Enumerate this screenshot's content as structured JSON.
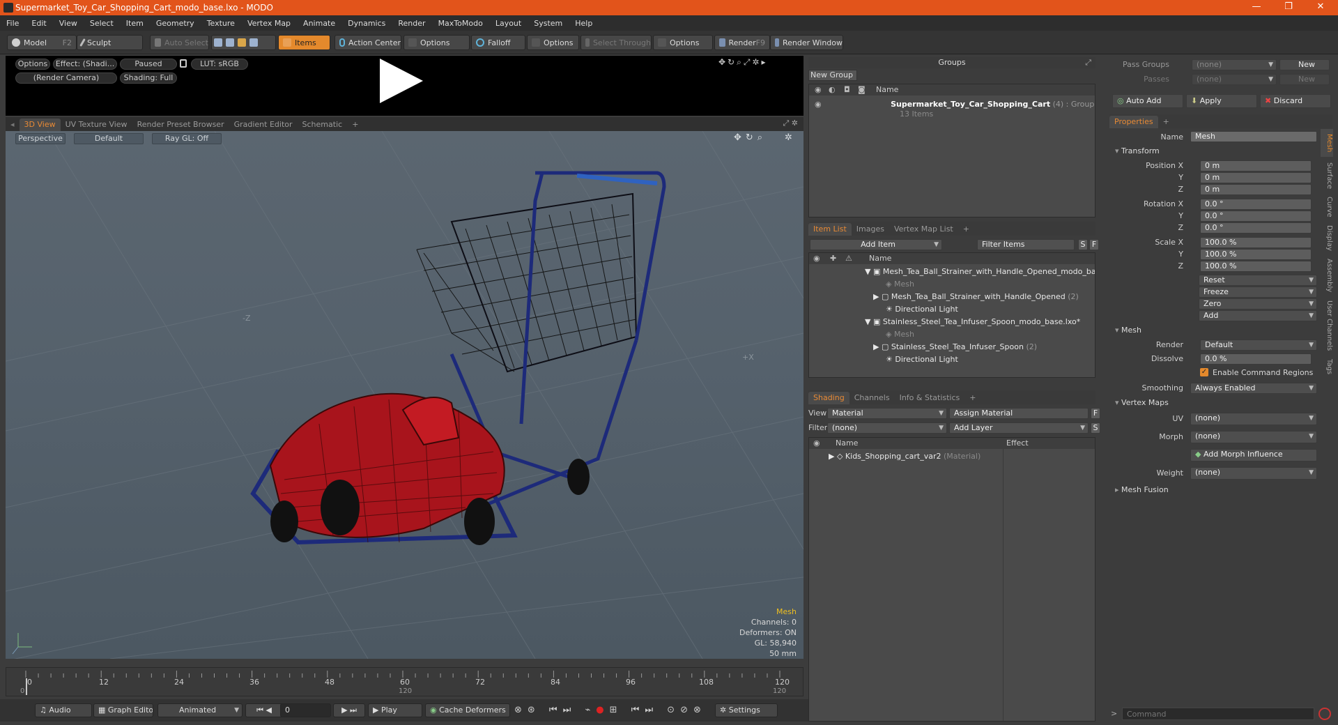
{
  "window": {
    "title": "Supermarket_Toy_Car_Shopping_Cart_modo_base.lxo - MODO"
  },
  "menu": [
    "File",
    "Edit",
    "View",
    "Select",
    "Item",
    "Geometry",
    "Texture",
    "Vertex Map",
    "Animate",
    "Dynamics",
    "Render",
    "MaxToModo",
    "Layout",
    "System",
    "Help"
  ],
  "toolbar": {
    "model": "Model",
    "model_key": "F2",
    "sculpt": "Sculpt",
    "auto_select": "Auto Select",
    "items": "Items",
    "action_center": "Action Center",
    "options": "Options",
    "falloff": "Falloff",
    "select_through": "Select Through",
    "render": "Render",
    "render_key": "F9",
    "render_window": "Render Window"
  },
  "preview": {
    "options": "Options",
    "effect": "Effect: (Shadi...",
    "paused": "Paused",
    "lut": "LUT: sRGB",
    "camera": "(Render Camera)",
    "shading": "Shading: Full"
  },
  "viewport_tabs": [
    "3D View",
    "UV Texture View",
    "Render Preset Browser",
    "Gradient Editor",
    "Schematic",
    "+"
  ],
  "viewport": {
    "perspective": "Perspective",
    "default": "Default",
    "raygl": "Ray GL: Off",
    "axis_z": "-Z",
    "axis_x": "+X",
    "info": {
      "mesh": "Mesh",
      "channels": "Channels: 0",
      "deformers": "Deformers: ON",
      "gl": "GL: 58,940",
      "focal": "50 mm"
    }
  },
  "timeline": {
    "ticks": [
      "0",
      "12",
      "24",
      "36",
      "48",
      "60",
      "72",
      "84",
      "96",
      "108",
      "120"
    ],
    "end": "120",
    "sub0": "0",
    "sub120": "120"
  },
  "bottom": {
    "audio": "Audio",
    "graph_editor": "Graph Editor",
    "animated": "Animated",
    "frame": "0",
    "play": "Play",
    "cache": "Cache Deformers",
    "settings": "Settings"
  },
  "groups": {
    "title": "Groups",
    "new_group": "New Group",
    "col_name": "Name",
    "item_name": "Supermarket_Toy_Car_Shopping_Cart",
    "item_count": "(4)",
    "item_type": ": Group",
    "item_sub": "13 Items"
  },
  "itemlist": {
    "tabs": [
      "Item List",
      "Images",
      "Vertex Map List",
      "+"
    ],
    "add_item": "Add Item",
    "filter": "Filter Items",
    "s": "S",
    "f": "F",
    "col_name": "Name",
    "rows": [
      {
        "label": "Mesh_Tea_Ball_Strainer_with_Handle_Opened_modo_bas ...",
        "count": ""
      },
      {
        "label": "Mesh",
        "count": ""
      },
      {
        "label": "Mesh_Tea_Ball_Strainer_with_Handle_Opened",
        "count": "(2)"
      },
      {
        "label": "Directional Light",
        "count": ""
      },
      {
        "label": "Stainless_Steel_Tea_Infuser_Spoon_modo_base.lxo*",
        "count": ""
      },
      {
        "label": "Mesh",
        "count": ""
      },
      {
        "label": "Stainless_Steel_Tea_Infuser_Spoon",
        "count": "(2)"
      },
      {
        "label": "Directional Light",
        "count": ""
      }
    ]
  },
  "shading": {
    "tabs": [
      "Shading",
      "Channels",
      "Info & Statistics",
      "+"
    ],
    "view_label": "View",
    "view_val": "Material",
    "assign": "Assign Material",
    "filter_label": "Filter",
    "filter_val": "(none)",
    "add_layer": "Add Layer",
    "s": "S",
    "f": "F",
    "col_name": "Name",
    "col_effect": "Effect",
    "material": "Kids_Shopping_cart_var2",
    "material_type": "(Material)"
  },
  "passes": {
    "pass_groups": "Pass Groups",
    "passes": "Passes",
    "none": "(none)",
    "new": "New"
  },
  "actions": {
    "auto_add": "Auto Add",
    "apply": "Apply",
    "discard": "Discard"
  },
  "properties": {
    "tab": "Properties",
    "plus": "+",
    "name_label": "Name",
    "name_val": "Mesh",
    "transform": "Transform",
    "pos_label": "Position X",
    "y": "Y",
    "z": "Z",
    "pos": [
      "0 m",
      "0 m",
      "0 m"
    ],
    "rot_label": "Rotation X",
    "rot": [
      "0.0 °",
      "0.0 °",
      "0.0 °"
    ],
    "scale_label": "Scale X",
    "scale": [
      "100.0 %",
      "100.0 %",
      "100.0 %"
    ],
    "buttons": [
      "Reset",
      "Freeze",
      "Zero",
      "Add"
    ],
    "mesh": "Mesh",
    "render_label": "Render",
    "render_val": "Default",
    "dissolve_label": "Dissolve",
    "dissolve_val": "0.0 %",
    "enable_cmd": "Enable Command Regions",
    "smoothing_label": "Smoothing",
    "smoothing_val": "Always Enabled",
    "vertex_maps": "Vertex Maps",
    "uv_label": "UV",
    "uv_val": "(none)",
    "morph_label": "Morph",
    "morph_val": "(none)",
    "add_morph": "Add Morph Influence",
    "weight_label": "Weight",
    "weight_val": "(none)",
    "mesh_fusion": "Mesh Fusion",
    "vtabs": [
      "Mesh",
      "Surface",
      "Curve",
      "Display",
      "Assembly",
      "User Channels",
      "Tags"
    ]
  },
  "command": {
    "placeholder": "Command"
  },
  "colors": {
    "accent": "#e4892c",
    "titlebar": "#e2541b",
    "cart_blue": "#1d2a7a",
    "car_red": "#a8141c"
  }
}
